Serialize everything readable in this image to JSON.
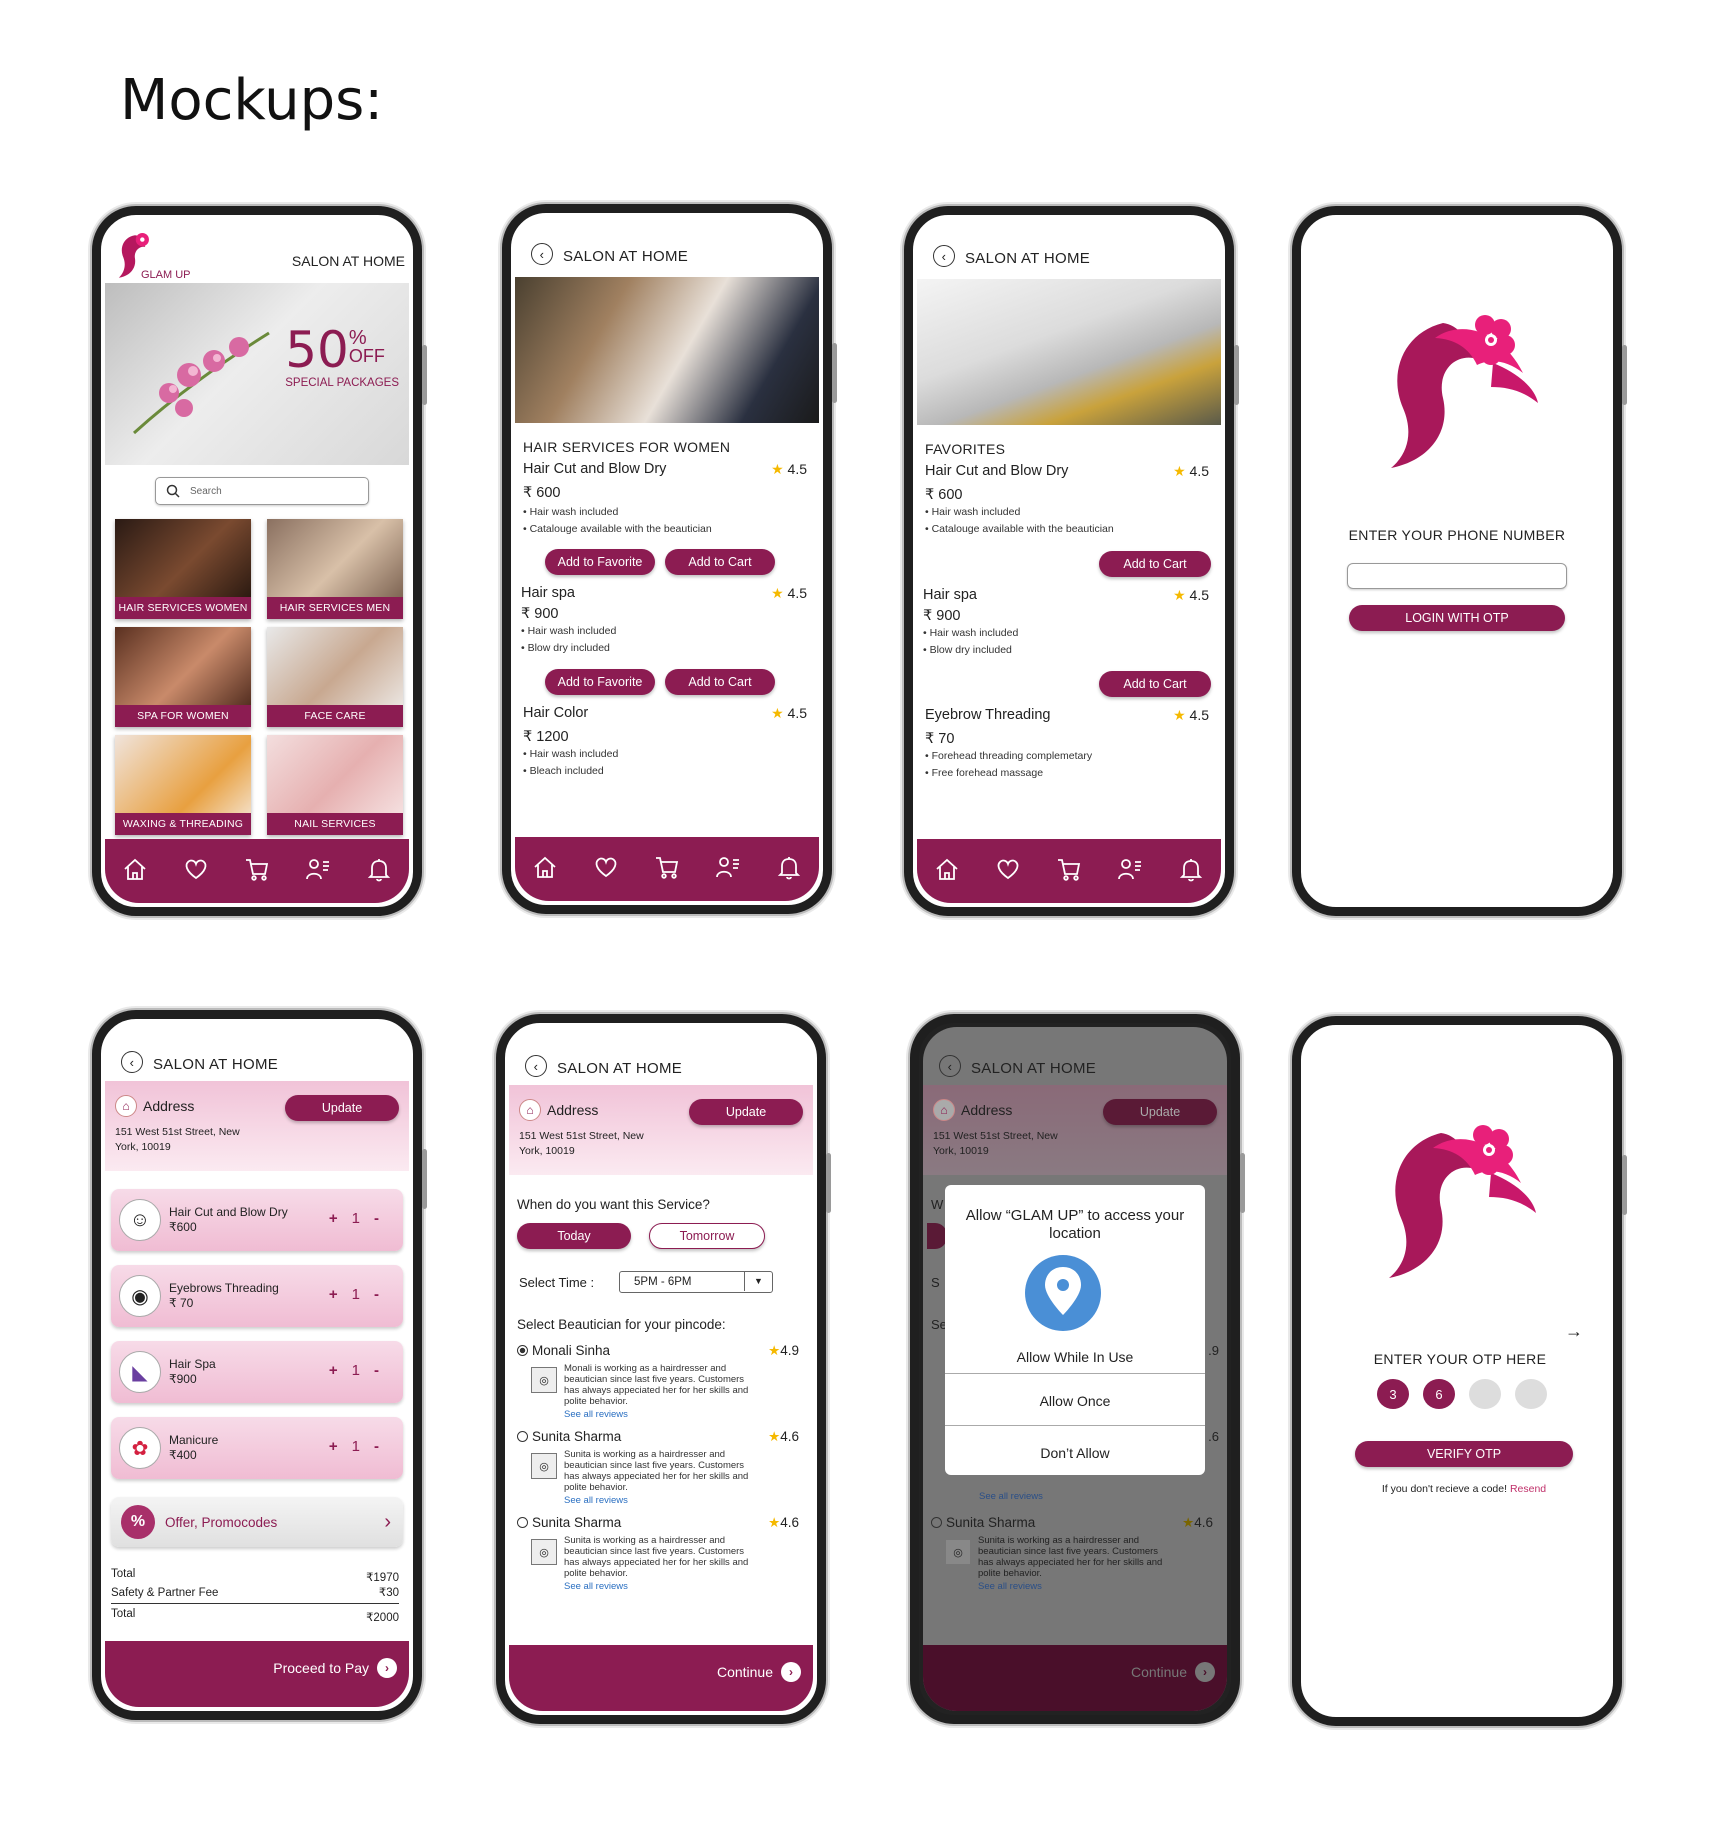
{
  "page": {
    "title": "Mockups:"
  },
  "colors": {
    "brand": "#8c1c52",
    "brand_light": "#f0bcd3",
    "star": "#f5b900",
    "link": "#2a6fc1",
    "pin": "#4a8fd6"
  },
  "common": {
    "header": "SALON AT HOME",
    "tab_icons": [
      "home-icon",
      "heart-icon",
      "cart-icon",
      "profile-list-icon",
      "bell-icon"
    ]
  },
  "home": {
    "logo_text": "GLAM UP",
    "header": "SALON AT HOME",
    "banner_big": "50",
    "banner_pct": "%",
    "banner_off": "OFF",
    "banner_sub": "SPECIAL PACKAGES",
    "search_placeholder": "Search",
    "tiles": [
      "HAIR SERVICES WOMEN",
      "HAIR SERVICES MEN",
      "SPA FOR WOMEN",
      "FACE CARE",
      "WAXING & THREADING",
      "NAIL SERVICES"
    ]
  },
  "hair": {
    "section": "HAIR SERVICES FOR WOMEN",
    "fav_label": "Add to Favorite",
    "cart_label": "Add to Cart",
    "services": [
      {
        "name": "Hair Cut and Blow Dry",
        "rating": "4.5",
        "price": "₹ 600",
        "bullets": [
          "Hair wash included",
          "Catalouge available with the beautician"
        ]
      },
      {
        "name": "Hair spa",
        "rating": "4.5",
        "price": "₹ 900",
        "bullets": [
          "Hair wash included",
          "Blow dry included"
        ]
      },
      {
        "name": "Hair Color",
        "rating": "4.5",
        "price": "₹ 1200",
        "bullets": [
          "Hair wash included",
          "Bleach included"
        ]
      }
    ]
  },
  "fav": {
    "section": "FAVORITES",
    "cart_label": "Add to Cart",
    "services": [
      {
        "name": "Hair Cut and Blow Dry",
        "rating": "4.5",
        "price": "₹ 600",
        "bullets": [
          "Hair wash included",
          "Catalouge available with the beautician"
        ]
      },
      {
        "name": "Hair spa",
        "rating": "4.5",
        "price": "₹ 900",
        "bullets": [
          "Hair wash included",
          "Blow dry included"
        ]
      },
      {
        "name": "Eyebrow Threading",
        "rating": "4.5",
        "price": "₹ 70",
        "bullets": [
          "Forehead threading complemetary",
          "Free forehead massage"
        ]
      }
    ]
  },
  "login": {
    "prompt": "ENTER YOUR  PHONE NUMBER",
    "button": "LOGIN WITH OTP"
  },
  "cart": {
    "address_label": "Address",
    "update": "Update",
    "address": "151 West 51st Street, New York, 10019",
    "items": [
      {
        "name": "Hair Cut and Blow Dry",
        "price": "₹600",
        "icon": "face-icon"
      },
      {
        "name": "Eyebrows Threading",
        "price": "₹ 70",
        "icon": "eye-icon"
      },
      {
        "name": "Hair Spa",
        "price": "₹900",
        "icon": "hair-dryer-icon"
      },
      {
        "name": "Manicure",
        "price": "₹400",
        "icon": "nail-icon"
      }
    ],
    "qty_plus": "+",
    "qty": "1",
    "qty_minus": "-",
    "offer": "Offer, Promocodes",
    "rows": [
      {
        "label": "Total",
        "value": "₹1970"
      },
      {
        "label": "Safety & Partner Fee",
        "value": "₹30"
      },
      {
        "label": "Total",
        "value": "₹2000"
      }
    ],
    "cta": "Proceed to Pay"
  },
  "schedule": {
    "address_label": "Address",
    "update": "Update",
    "address": "151 West 51st Street, New York, 10019",
    "question": "When do you want this Service?",
    "today": "Today",
    "tomorrow": "Tomorrow",
    "time_label": "Select Time :",
    "time_value": "5PM - 6PM",
    "pick": "Select Beautician for your pincode:",
    "beauticians": [
      {
        "name": "Monali Sinha",
        "rating": "4.9",
        "desc": "Monali is working as a hairdresser and beautician since last five years. Customers has always appeciated her for her skills and polite behavior.",
        "see": "See all reviews"
      },
      {
        "name": "Sunita Sharma",
        "rating": "4.6",
        "desc": "Sunita is working as a hairdresser and beautician since last five years. Customers has always appeciated her for her skills and polite behavior.",
        "see": "See all reviews"
      },
      {
        "name": "Sunita Sharma",
        "rating": "4.6",
        "desc": "Sunita is working as a hairdresser and beautician since last five years. Customers has always appeciated her for her skills and polite behavior.",
        "see": "See all reviews"
      }
    ],
    "cta": "Continue"
  },
  "location": {
    "title": "Allow “GLAM UP” to access your location",
    "while": "Allow While  In Use",
    "once": "Allow Once",
    "deny": "Don’t Allow",
    "bg_partial_w": "W",
    "bg_partial_s": "S",
    "bg_partial_se": "Se",
    "bg_rating": ".9",
    "bg_rating2": ".6"
  },
  "otp": {
    "prompt": "ENTER YOUR  OTP HERE",
    "digits": [
      "3",
      "6",
      "",
      ""
    ],
    "button": "VERIFY OTP",
    "resend_text": "If you don't recieve a code!",
    "resend_link": "Resend"
  }
}
